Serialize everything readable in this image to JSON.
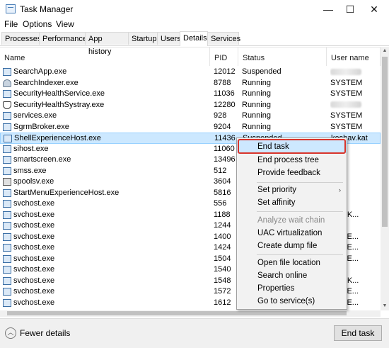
{
  "window": {
    "title": "Task Manager",
    "minimize_glyph": "—",
    "maximize_glyph": "☐",
    "close_glyph": "✕"
  },
  "menu": [
    "File",
    "Options",
    "View"
  ],
  "tabs": [
    "Processes",
    "Performance",
    "App history",
    "Startup",
    "Users",
    "Details",
    "Services"
  ],
  "active_tab": "Details",
  "columns": {
    "name": "Name",
    "pid": "PID",
    "status": "Status",
    "user": "User name"
  },
  "rows": [
    {
      "name": "SearchApp.exe",
      "pid": "12012",
      "status": "Suspended",
      "user": "",
      "icon": "window-icon"
    },
    {
      "name": "SearchIndexer.exe",
      "pid": "8788",
      "status": "Running",
      "user": "SYSTEM",
      "icon": "user-icon"
    },
    {
      "name": "SecurityHealthService.exe",
      "pid": "11036",
      "status": "Running",
      "user": "SYSTEM",
      "icon": "window-icon"
    },
    {
      "name": "SecurityHealthSystray.exe",
      "pid": "12280",
      "status": "Running",
      "user": "",
      "icon": "shield-icon"
    },
    {
      "name": "services.exe",
      "pid": "928",
      "status": "Running",
      "user": "SYSTEM",
      "icon": "window-icon"
    },
    {
      "name": "SgrmBroker.exe",
      "pid": "9204",
      "status": "Running",
      "user": "SYSTEM",
      "icon": "window-icon"
    },
    {
      "name": "ShellExperienceHost.exe",
      "pid": "11436",
      "status": "Suspended",
      "user": "keshav.kat",
      "icon": "window-icon",
      "selected": true
    },
    {
      "name": "sihost.exe",
      "pid": "11060",
      "status": "",
      "user": "v.kat",
      "icon": "window-icon"
    },
    {
      "name": "smartscreen.exe",
      "pid": "13496",
      "status": "",
      "user": "v.kat",
      "icon": "window-icon"
    },
    {
      "name": "smss.exe",
      "pid": "512",
      "status": "",
      "user": "EM",
      "icon": "window-icon"
    },
    {
      "name": "spoolsv.exe",
      "pid": "3604",
      "status": "",
      "user": "EM",
      "icon": "printer-icon"
    },
    {
      "name": "StartMenuExperienceHost.exe",
      "pid": "5816",
      "status": "",
      "user": "v.kat",
      "icon": "window-icon"
    },
    {
      "name": "svchost.exe",
      "pid": "556",
      "status": "",
      "user": "EM",
      "icon": "window-icon"
    },
    {
      "name": "svchost.exe",
      "pid": "1188",
      "status": "",
      "user": "VORK...",
      "icon": "window-icon"
    },
    {
      "name": "svchost.exe",
      "pid": "1244",
      "status": "",
      "user": "EM",
      "icon": "window-icon"
    },
    {
      "name": "svchost.exe",
      "pid": "1400",
      "status": "",
      "user": "AL SE...",
      "icon": "window-icon"
    },
    {
      "name": "svchost.exe",
      "pid": "1424",
      "status": "",
      "user": "AL SE...",
      "icon": "window-icon"
    },
    {
      "name": "svchost.exe",
      "pid": "1504",
      "status": "",
      "user": "AL SE...",
      "icon": "window-icon"
    },
    {
      "name": "svchost.exe",
      "pid": "1540",
      "status": "",
      "user": "EM",
      "icon": "window-icon"
    },
    {
      "name": "svchost.exe",
      "pid": "1548",
      "status": "",
      "user": "VORK...",
      "icon": "window-icon"
    },
    {
      "name": "svchost.exe",
      "pid": "1572",
      "status": "",
      "user": "AL SE...",
      "icon": "window-icon"
    },
    {
      "name": "svchost.exe",
      "pid": "1612",
      "status": "",
      "user": "AL SE...",
      "icon": "window-icon"
    }
  ],
  "context_menu": {
    "end_task": "End task",
    "end_process_tree": "End process tree",
    "provide_feedback": "Provide feedback",
    "set_priority": "Set priority",
    "set_affinity": "Set affinity",
    "analyze_wait_chain": "Analyze wait chain",
    "uac_virtualization": "UAC virtualization",
    "create_dump_file": "Create dump file",
    "open_file_location": "Open file location",
    "search_online": "Search online",
    "properties": "Properties",
    "go_to_services": "Go to service(s)",
    "submenu_glyph": "›"
  },
  "footer": {
    "fewer_details": "Fewer details",
    "end_task_button": "End task"
  },
  "colors": {
    "selection": "#cce8ff",
    "highlight_box": "#d9342b"
  }
}
